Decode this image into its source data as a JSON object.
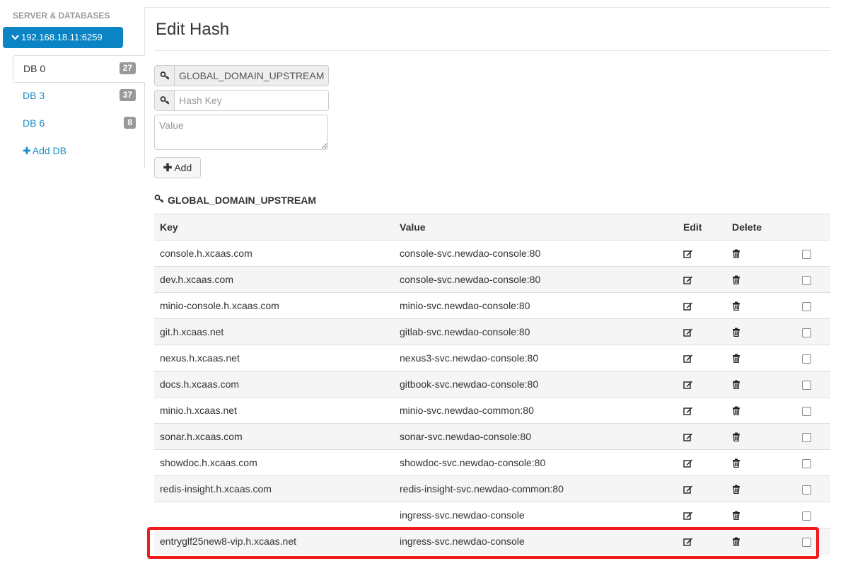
{
  "sidebar": {
    "heading": "SERVER & DATABASES",
    "server": "192.168.18.11:6259",
    "dbs": [
      {
        "label": "DB 0",
        "count": "27",
        "active": true
      },
      {
        "label": "DB 3",
        "count": "37",
        "active": false
      },
      {
        "label": "DB 6",
        "count": "8",
        "active": false
      }
    ],
    "add_db": "Add DB"
  },
  "main": {
    "title": "Edit Hash",
    "hash_name_value": "GLOBAL_DOMAIN_UPSTREAM",
    "hash_key_placeholder": "Hash Key",
    "value_placeholder": "Value",
    "add_label": "Add",
    "hash_heading": "GLOBAL_DOMAIN_UPSTREAM"
  },
  "table": {
    "headers": {
      "key": "Key",
      "value": "Value",
      "edit": "Edit",
      "delete": "Delete"
    },
    "rows": [
      {
        "key": "console.h.xcaas.com",
        "value": "console-svc.newdao-console:80"
      },
      {
        "key": "dev.h.xcaas.com",
        "value": "console-svc.newdao-console:80"
      },
      {
        "key": "minio-console.h.xcaas.com",
        "value": "minio-svc.newdao-console:80"
      },
      {
        "key": "git.h.xcaas.net",
        "value": "gitlab-svc.newdao-console:80"
      },
      {
        "key": "nexus.h.xcaas.net",
        "value": "nexus3-svc.newdao-console:80"
      },
      {
        "key": "docs.h.xcaas.com",
        "value": "gitbook-svc.newdao-console:80"
      },
      {
        "key": "minio.h.xcaas.net",
        "value": "minio-svc.newdao-common:80"
      },
      {
        "key": "sonar.h.xcaas.com",
        "value": "sonar-svc.newdao-console:80"
      },
      {
        "key": "showdoc.h.xcaas.com",
        "value": "showdoc-svc.newdao-console:80"
      },
      {
        "key": "redis-insight.h.xcaas.com",
        "value": "redis-insight-svc.newdao-common:80"
      },
      {
        "key": "",
        "value": "ingress-svc.newdao-console"
      },
      {
        "key": "entryglf25new8-vip.h.xcaas.net",
        "value": "ingress-svc.newdao-console"
      }
    ]
  },
  "colors": {
    "accent": "#0a84c4",
    "link": "#1a8dc5",
    "highlight": "#ee1c1c",
    "badge": "#999999"
  },
  "icons": {
    "key": "key-icon",
    "edit": "edit-icon",
    "delete": "trash-icon",
    "chevron": "chevron-down-icon",
    "plus": "plus-icon"
  }
}
